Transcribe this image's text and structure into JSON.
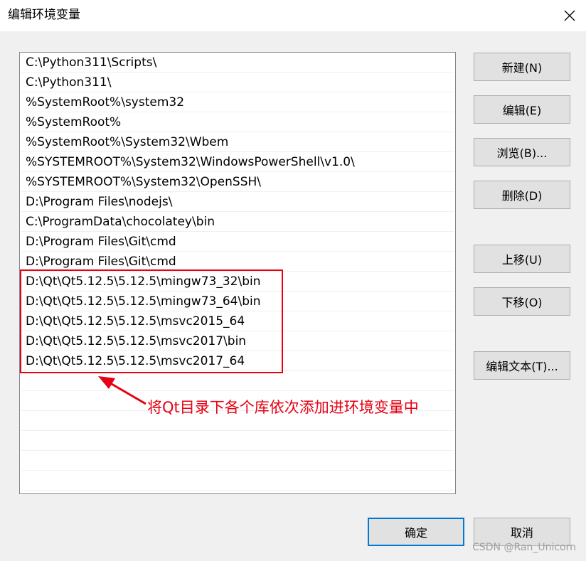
{
  "window": {
    "title": "编辑环境变量"
  },
  "path_entries": [
    "C:\\Python311\\Scripts\\",
    "C:\\Python311\\",
    "%SystemRoot%\\system32",
    "%SystemRoot%",
    "%SystemRoot%\\System32\\Wbem",
    "%SYSTEMROOT%\\System32\\WindowsPowerShell\\v1.0\\",
    "%SYSTEMROOT%\\System32\\OpenSSH\\",
    "D:\\Program Files\\nodejs\\",
    "C:\\ProgramData\\chocolatey\\bin",
    "D:\\Program Files\\Git\\cmd",
    "D:\\Program Files\\Git\\cmd",
    "D:\\Qt\\Qt5.12.5\\5.12.5\\mingw73_32\\bin",
    "D:\\Qt\\Qt5.12.5\\5.12.5\\mingw73_64\\bin",
    "D:\\Qt\\Qt5.12.5\\5.12.5\\msvc2015_64",
    "D:\\Qt\\Qt5.12.5\\5.12.5\\msvc2017\\bin",
    "D:\\Qt\\Qt5.12.5\\5.12.5\\msvc2017_64"
  ],
  "buttons": {
    "new": "新建(N)",
    "edit": "编辑(E)",
    "browse": "浏览(B)...",
    "delete": "删除(D)",
    "move_up": "上移(U)",
    "move_down": "下移(O)",
    "edit_text": "编辑文本(T)...",
    "ok": "确定",
    "cancel": "取消"
  },
  "annotation": {
    "text": "将Qt目录下各个库依次添加进环境变量中",
    "color": "#e60012"
  },
  "watermark": "CSDN @Ran_Unicorn",
  "colors": {
    "default_button_border": "#0078d7",
    "annotation_red": "#e60012"
  }
}
